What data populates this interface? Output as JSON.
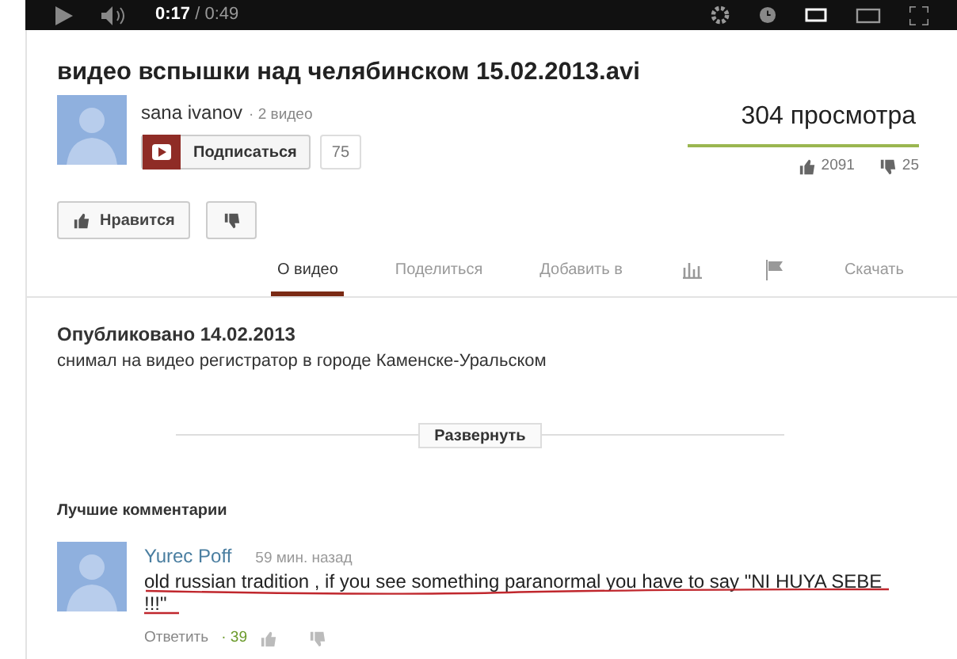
{
  "player": {
    "time_current": "0:17",
    "time_total": "/ 0:49"
  },
  "video": {
    "title": "видео вспышки над челябинском 15.02.2013.avi",
    "channel": "sana ivanov",
    "video_count": "· 2 видео",
    "subscribe_label": "Подписаться",
    "subscriber_count": "75",
    "views": "304 просмотра",
    "likes": "2091",
    "dislikes": "25",
    "like_label": "Нравится"
  },
  "tabs": [
    {
      "kind": "text",
      "label": "О видео",
      "selected": true
    },
    {
      "kind": "text",
      "label": "Поделиться",
      "selected": false
    },
    {
      "kind": "text",
      "label": "Добавить в",
      "selected": false
    },
    {
      "kind": "stats",
      "selected": false
    },
    {
      "kind": "flag",
      "selected": false
    },
    {
      "kind": "text",
      "label": "Скачать",
      "selected": false
    }
  ],
  "description": {
    "published": "Опубликовано 14.02.2013",
    "text": "снимал на видео регистратор в городе Каменске-Уральском",
    "expand_label": "Развернуть"
  },
  "comments": {
    "heading": "Лучшие комментарии",
    "items": [
      {
        "author": "Yurec Poff",
        "time": "59 мин. назад",
        "text": "old russian tradition , if you see something paranormal you have to say \"NI HUYA SEBE !!!\"",
        "underlined": true,
        "reply_label": "Ответить",
        "score": "· 39"
      }
    ]
  }
}
